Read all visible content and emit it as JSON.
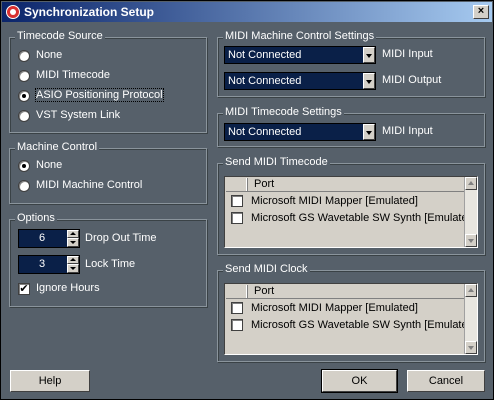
{
  "window": {
    "title": "Synchronization Setup",
    "close_label": "×"
  },
  "timecode_source": {
    "title": "Timecode Source",
    "options": [
      {
        "label": "None",
        "checked": false
      },
      {
        "label": "MIDI Timecode",
        "checked": false
      },
      {
        "label": "ASIO Positioning Protocol",
        "checked": true
      },
      {
        "label": "VST System Link",
        "checked": false
      }
    ]
  },
  "machine_control": {
    "title": "Machine Control",
    "options": [
      {
        "label": "None",
        "checked": true
      },
      {
        "label": "MIDI Machine Control",
        "checked": false
      }
    ]
  },
  "options": {
    "title": "Options",
    "drop_out_time": {
      "value": "6",
      "label": "Drop Out Time"
    },
    "lock_time": {
      "value": "3",
      "label": "Lock Time"
    },
    "ignore_hours": {
      "label": "Ignore Hours",
      "checked": true,
      "mark": "✔"
    }
  },
  "mmc_settings": {
    "title": "MIDI Machine Control Settings",
    "midi_input": {
      "value": "Not Connected",
      "label": "MIDI Input"
    },
    "midi_output": {
      "value": "Not Connected",
      "label": "MIDI Output"
    }
  },
  "mtc_settings": {
    "title": "MIDI Timecode Settings",
    "midi_input": {
      "value": "Not Connected",
      "label": "MIDI Input"
    }
  },
  "send_mtc": {
    "title": "Send MIDI Timecode",
    "column_header": "Port",
    "ports": [
      "Microsoft MIDI Mapper [Emulated]",
      "Microsoft GS Wavetable SW Synth [Emulate"
    ]
  },
  "send_clock": {
    "title": "Send MIDI Clock",
    "column_header": "Port",
    "ports": [
      "Microsoft MIDI Mapper [Emulated]",
      "Microsoft GS Wavetable SW Synth [Emulate"
    ]
  },
  "buttons": {
    "help": "Help",
    "ok": "OK",
    "cancel": "Cancel"
  }
}
